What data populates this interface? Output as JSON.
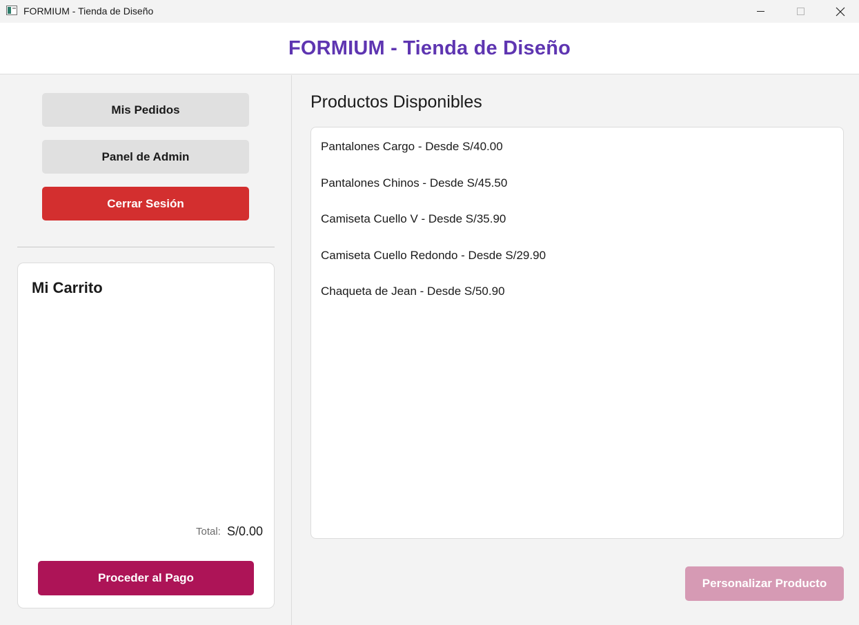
{
  "window": {
    "title": "FORMIUM - Tienda de Diseño"
  },
  "header": {
    "title": "FORMIUM - Tienda de Diseño"
  },
  "sidebar": {
    "orders_label": "Mis Pedidos",
    "admin_label": "Panel de Admin",
    "logout_label": "Cerrar Sesión"
  },
  "cart": {
    "title": "Mi Carrito",
    "items": [],
    "total_label": "Total:",
    "total_value": "S/0.00",
    "checkout_label": "Proceder al Pago"
  },
  "main": {
    "heading": "Productos Disponibles",
    "products": [
      "Pantalones Cargo - Desde S/40.00",
      "Pantalones Chinos - Desde S/45.50",
      "Camiseta Cuello V - Desde S/35.90",
      "Camiseta Cuello Redondo - Desde S/29.90",
      "Chaqueta de Jean - Desde S/50.90"
    ],
    "customize_label": "Personalizar Producto",
    "customize_enabled": false
  },
  "colors": {
    "brand": "#5e35b1",
    "logout": "#d32f2f",
    "checkout": "#ad1457",
    "customize_disabled": "#d69ab4"
  }
}
